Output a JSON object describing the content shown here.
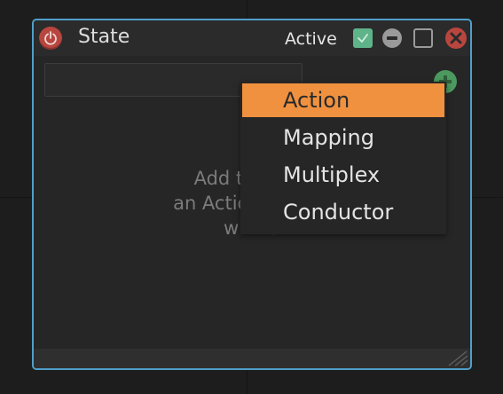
{
  "window": {
    "title": "State",
    "active_label": "Active",
    "active_checked": true
  },
  "search": {
    "value": "",
    "placeholder": ""
  },
  "empty_state": {
    "line1": "Add trigger i",
    "line2": "an Action, or con",
    "line3": "with a"
  },
  "menu": {
    "items": [
      {
        "label": "Action",
        "selected": true
      },
      {
        "label": "Mapping",
        "selected": false
      },
      {
        "label": "Multiplex",
        "selected": false
      },
      {
        "label": "Conductor",
        "selected": false
      }
    ]
  },
  "colors": {
    "window_border": "#4f9fc9",
    "menu_highlight": "#f0913f",
    "power_red": "#b8463f",
    "check_green": "#5fb389",
    "add_green": "#4c9a5f"
  },
  "icons": {
    "power": "power-icon",
    "check": "check-icon",
    "minimize": "minus-icon",
    "maximize": "square-icon",
    "close": "close-icon",
    "add": "plus-icon",
    "resize": "resize-grip-icon"
  }
}
